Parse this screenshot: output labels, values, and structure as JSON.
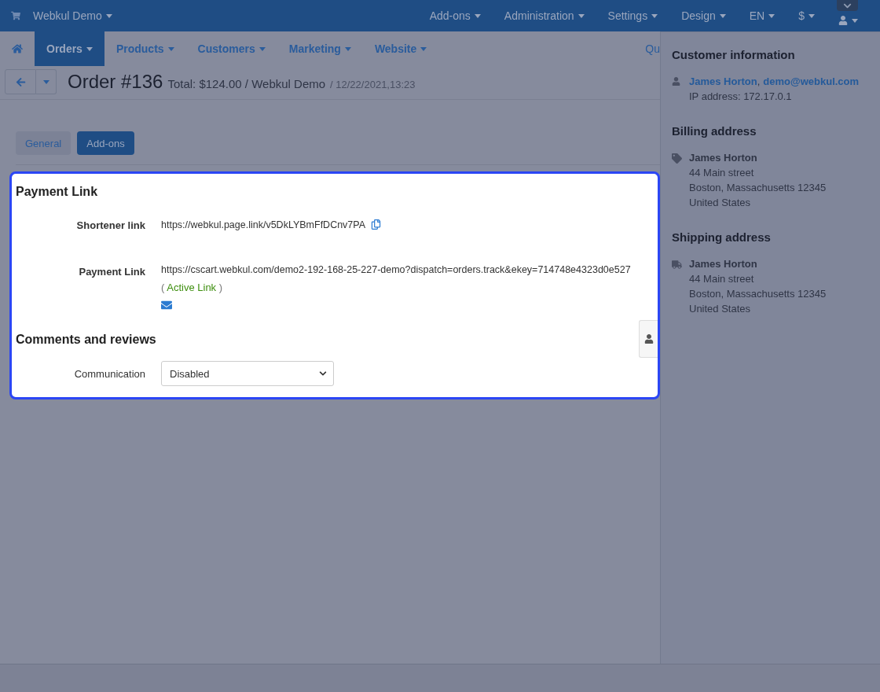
{
  "top_bar": {
    "store": "Webkul Demo",
    "menus": [
      "Add-ons",
      "Administration",
      "Settings",
      "Design",
      "EN",
      "$"
    ]
  },
  "nav": {
    "items": [
      {
        "label": "Orders",
        "selected": true
      },
      {
        "label": "Products",
        "selected": false
      },
      {
        "label": "Customers",
        "selected": false
      },
      {
        "label": "Marketing",
        "selected": false
      },
      {
        "label": "Website",
        "selected": false
      }
    ],
    "quick_link": "Qu"
  },
  "order": {
    "title": "Order #136",
    "total": "Total: $124.00 / Webkul Demo",
    "date": "/ 12/22/2021,13:23"
  },
  "tabs": [
    {
      "label": "General",
      "selected": false
    },
    {
      "label": "Add-ons",
      "selected": true
    }
  ],
  "panel": {
    "title": "Payment Link",
    "shortener_label": "Shortener link",
    "shortener_url": "https://webkul.page.link/v5DkLYBmFfDCnv7PA",
    "payment_label": "Payment Link",
    "payment_url": "https://cscart.webkul.com/demo2-192-168-25-227-demo?dispatch=orders.track&ekey=714748e4323d0e527",
    "status_open": "(",
    "status": "Active Link",
    "status_close": ")",
    "comments_title": "Comments and reviews",
    "communication_label": "Communication",
    "communication_value": "Disabled"
  },
  "sidebar": {
    "customer": {
      "title": "Customer information",
      "name": "James Horton",
      "separator": ",",
      "email": "demo@webkul.com",
      "ip": "IP address: 172.17.0.1"
    },
    "billing": {
      "title": "Billing address",
      "name": "James Horton",
      "lines": [
        "44 Main street",
        "Boston, Massachusetts 12345",
        "United States"
      ]
    },
    "shipping": {
      "title": "Shipping address",
      "name": "James Horton",
      "lines": [
        "44 Main street",
        "Boston, Massachusetts 12345",
        "United States"
      ]
    }
  }
}
